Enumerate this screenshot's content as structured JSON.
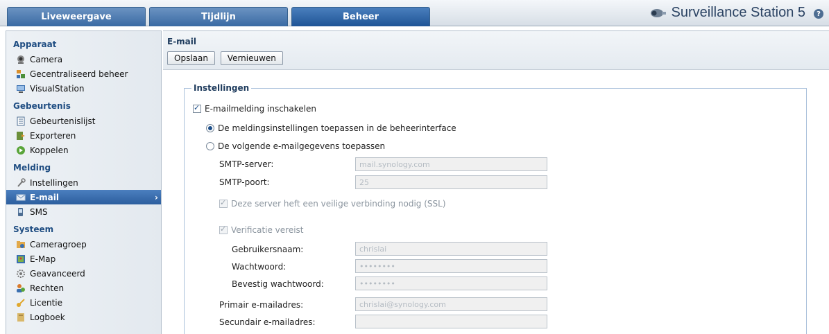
{
  "topbar": {
    "tabs": [
      {
        "label": "Liveweergave",
        "active": false
      },
      {
        "label": "Tijdlijn",
        "active": false
      },
      {
        "label": "Beheer",
        "active": true
      }
    ],
    "brand": "Surveillance Station 5",
    "help": "?",
    "icons": {
      "brand": "camera-icon",
      "help": "help-icon"
    }
  },
  "sidebar": {
    "groups": [
      {
        "title": "Apparaat",
        "items": [
          {
            "label": "Camera",
            "icon": "camera-icon"
          },
          {
            "label": "Gecentraliseerd beheer",
            "icon": "centralized-management-icon"
          },
          {
            "label": "VisualStation",
            "icon": "visualstation-icon"
          }
        ]
      },
      {
        "title": "Gebeurtenis",
        "items": [
          {
            "label": "Gebeurtenislijst",
            "icon": "event-list-icon"
          },
          {
            "label": "Exporteren",
            "icon": "export-icon"
          },
          {
            "label": "Koppelen",
            "icon": "mount-icon"
          }
        ]
      },
      {
        "title": "Melding",
        "items": [
          {
            "label": "Instellingen",
            "icon": "wrench-icon"
          },
          {
            "label": "E-mail",
            "icon": "mail-icon",
            "selected": true
          },
          {
            "label": "SMS",
            "icon": "sms-icon"
          }
        ]
      },
      {
        "title": "Systeem",
        "items": [
          {
            "label": "Cameragroep",
            "icon": "camera-group-icon"
          },
          {
            "label": "E-Map",
            "icon": "emap-icon"
          },
          {
            "label": "Geavanceerd",
            "icon": "gear-icon"
          },
          {
            "label": "Rechten",
            "icon": "privileges-icon"
          },
          {
            "label": "Licentie",
            "icon": "key-icon"
          },
          {
            "label": "Logboek",
            "icon": "log-icon"
          }
        ]
      }
    ],
    "selected_arrow": "›"
  },
  "main": {
    "title": "E-mail",
    "buttons": {
      "save": "Opslaan",
      "refresh": "Vernieuwen"
    },
    "settings": {
      "legend": "Instellingen",
      "enable_label": "E-mailmelding inschakelen",
      "enable_checked": true,
      "radio_admin": "De meldingsinstellingen toepassen in de beheerinterface",
      "radio_custom": "De volgende e-mailgegevens toepassen",
      "selected_radio": "admin",
      "smtp_server_label": "SMTP-server:",
      "smtp_server_value": "mail.synology.com",
      "smtp_port_label": "SMTP-poort:",
      "smtp_port_value": "25",
      "ssl_label": "Deze server heft een veilige verbinding nodig (SSL)",
      "ssl_checked": true,
      "auth_label": "Verificatie vereist",
      "auth_checked": true,
      "username_label": "Gebruikersnaam:",
      "username_value": "chrislai",
      "password_label": "Wachtwoord:",
      "password_value": "••••••••",
      "confirm_label": "Bevestig wachtwoord:",
      "confirm_value": "••••••••",
      "primary_label": "Primair e-mailadres:",
      "primary_value": "chrislai@synology.com",
      "secondary_label": "Secundair e-mailadres:",
      "secondary_value": ""
    }
  },
  "colors": {
    "accent": "#2c5e9e",
    "group_title": "#1f4d82"
  }
}
